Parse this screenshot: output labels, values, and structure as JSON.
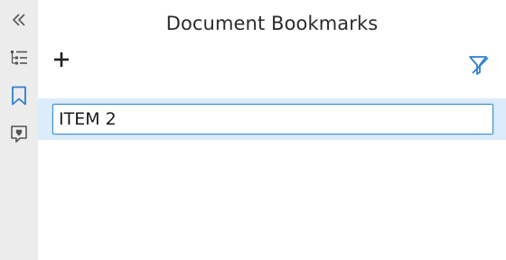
{
  "panel": {
    "title": "Document Bookmarks"
  },
  "rail": {
    "items": [
      {
        "icon": "collapse-double-chevron-left-icon"
      },
      {
        "icon": "outline-tree-list-icon"
      },
      {
        "icon": "bookmark-icon"
      },
      {
        "icon": "favorites-heart-icon"
      }
    ]
  },
  "toolbar": {
    "add_icon": "plus-icon",
    "filter_icon": "filter-off-icon"
  },
  "bookmarks": {
    "editing_value": "ITEM 2"
  },
  "colors": {
    "accent": "#2f7fd0",
    "selection": "#dcecfb",
    "rail_bg": "#ececec",
    "icon": "#4a4a4a"
  }
}
